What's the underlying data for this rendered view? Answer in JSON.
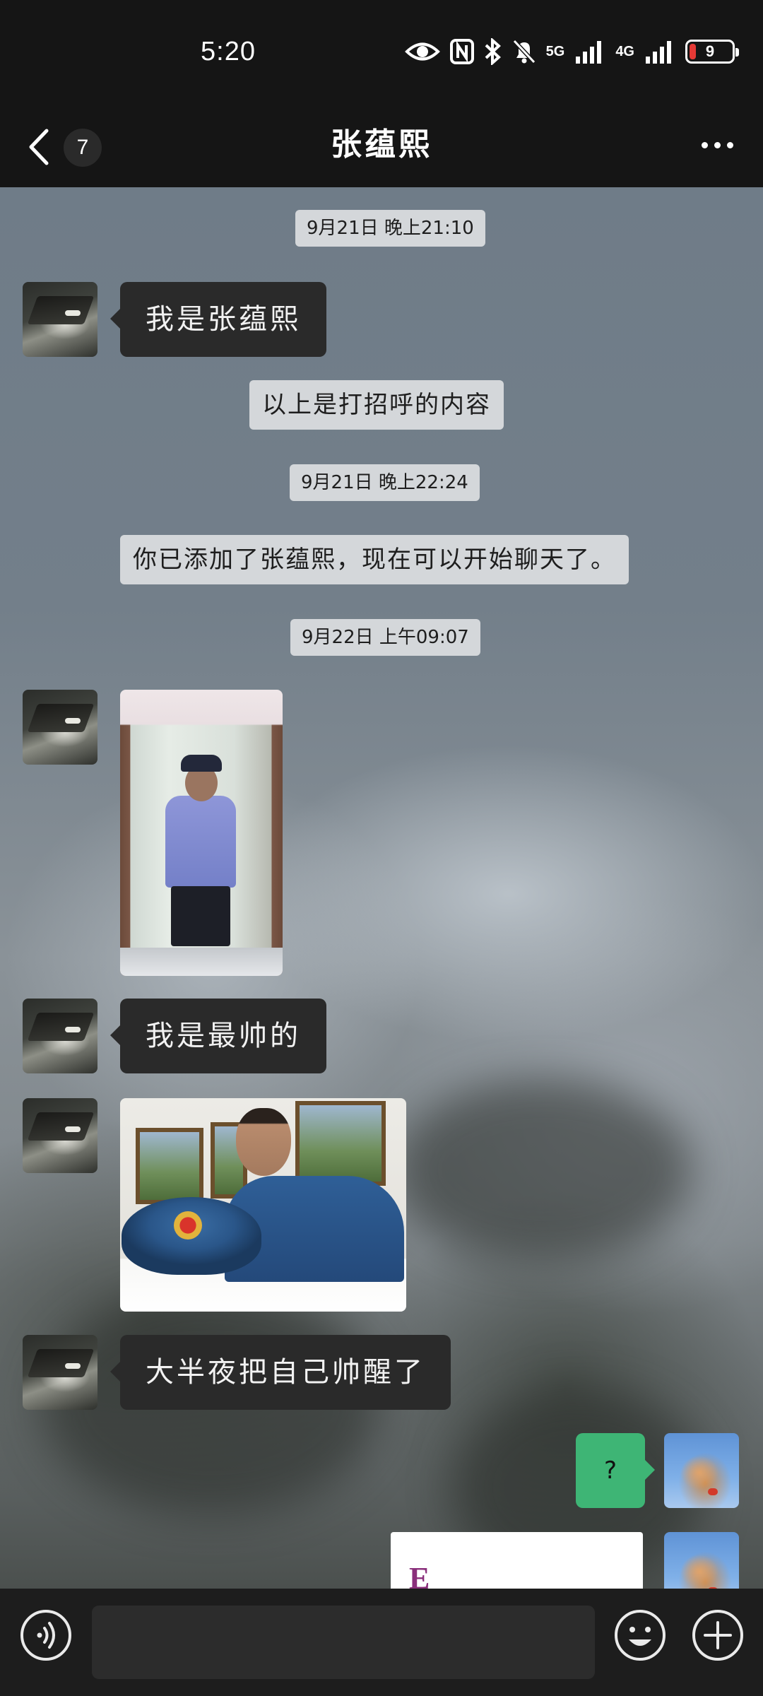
{
  "status_bar": {
    "time": "5:20",
    "network_1": "5G",
    "network_2": "4G",
    "battery_level": "9",
    "icons": [
      "eye-icon",
      "nfc-icon",
      "bluetooth-icon",
      "mute-bell-icon",
      "signal-icon",
      "signal-icon",
      "battery-icon"
    ]
  },
  "header": {
    "back_icon": "chevron-left-icon",
    "unread_count": "7",
    "title": "张蕴熙",
    "more_icon": "more-dots-icon"
  },
  "messages": {
    "time_1": "9月21日 晚上21:10",
    "msg_1": "我是张蕴熙",
    "sys_1": "以上是打招呼的内容",
    "time_2": "9月21日 晚上22:24",
    "sys_2": "你已添加了张蕴熙，现在可以开始聊天了。",
    "time_3": "9月22日 上午09:07",
    "msg_2": "我是最帅的",
    "msg_3": "大半夜把自己帅醒了",
    "my_msg_1": "?",
    "partial_card_text": "E"
  },
  "input_bar": {
    "voice_icon": "voice-icon",
    "input_value": "",
    "emoji_icon": "emoji-icon",
    "plus_icon": "plus-icon"
  },
  "colors": {
    "my_bubble": "#3eb575",
    "their_bubble": "#2a2a2a",
    "bar_background": "#151515"
  }
}
